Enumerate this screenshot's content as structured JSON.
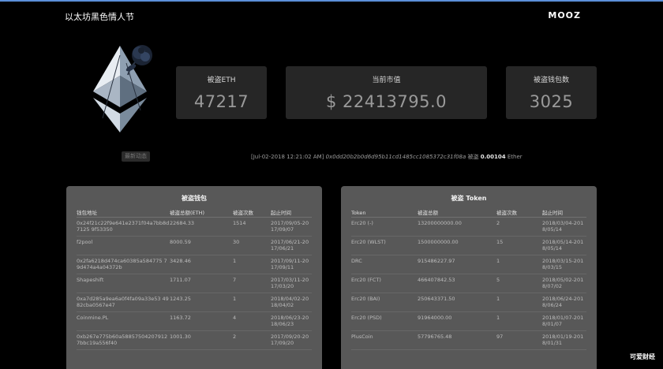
{
  "header": {
    "site_title": "以太坊黑色情人节",
    "brand": "MOOZ"
  },
  "stats": {
    "stolen_eth": {
      "label": "被盗ETH",
      "value": "47217"
    },
    "market_value": {
      "label": "当前市值",
      "value": "$ 22413795.0"
    },
    "wallet_count": {
      "label": "被盗钱包数",
      "value": "3025"
    }
  },
  "small_button": "最新动态",
  "ticker": {
    "time": "[Jul-02-2018 12:21:02 AM]",
    "hash": "0x0dd20b2b0d6d95b11cd1485cc1085372c31f08a",
    "label": "被盗",
    "amount": "0.00104",
    "unit": "Ether"
  },
  "wallets_panel": {
    "title": "被盗钱包",
    "columns": [
      "钱包地址",
      "被盗总额(ETH)",
      "被盗次数",
      "起止时间"
    ],
    "rows": [
      [
        "0x24f21c22f9e641e2371f04a7bb8d7125 9f53350",
        "22684.33",
        "1514",
        "2017/09/05-2017/09/07"
      ],
      [
        "f2pool",
        "8000.59",
        "30",
        "2017/06/21-2017/06/21"
      ],
      [
        "0x2fa6218d474ca60385a584775 79d474a4a04372b",
        "3428.46",
        "1",
        "2017/09/11-2017/09/11"
      ],
      [
        "Shapeshift",
        "1711.07",
        "7",
        "2017/03/11-2017/03/20"
      ],
      [
        "0xa7d285a9ea6a0f4fa09a33e53 4982cba0567e47",
        "1243.25",
        "1",
        "2018/04/02-2018/04/02"
      ],
      [
        "Coinmine.PL",
        "1163.72",
        "4",
        "2018/06/23-2018/06/23"
      ],
      [
        "0xb267e775b60a58857504207912 7bbc19a556f40",
        "1001.30",
        "2",
        "2017/09/20-2017/09/20"
      ]
    ]
  },
  "tokens_panel": {
    "title": "被盗 Token",
    "columns": [
      "Token",
      "被盗总额",
      "被盗次数",
      "起止时间"
    ],
    "rows": [
      [
        "Erc20 (-)",
        "13200000000.00",
        "2",
        "2018/03/04-2018/05/14"
      ],
      [
        "Erc20 (WLST)",
        "1500000000.00",
        "15",
        "2018/05/14-2018/05/14"
      ],
      [
        "DRC",
        "915486227.97",
        "1",
        "2018/03/15-2018/03/15"
      ],
      [
        "Erc20 (FCT)",
        "466407842.53",
        "5",
        "2018/05/02-2018/07/02"
      ],
      [
        "Erc20 (BAI)",
        "250643371.50",
        "1",
        "2018/06/24-2018/06/24"
      ],
      [
        "Erc20 (PSD)",
        "91964000.00",
        "1",
        "2018/01/07-2018/01/07"
      ],
      [
        "PlusCoin",
        "57796765.48",
        "97",
        "2018/01/19-2018/01/31"
      ]
    ]
  },
  "watermark": "可爱财经"
}
